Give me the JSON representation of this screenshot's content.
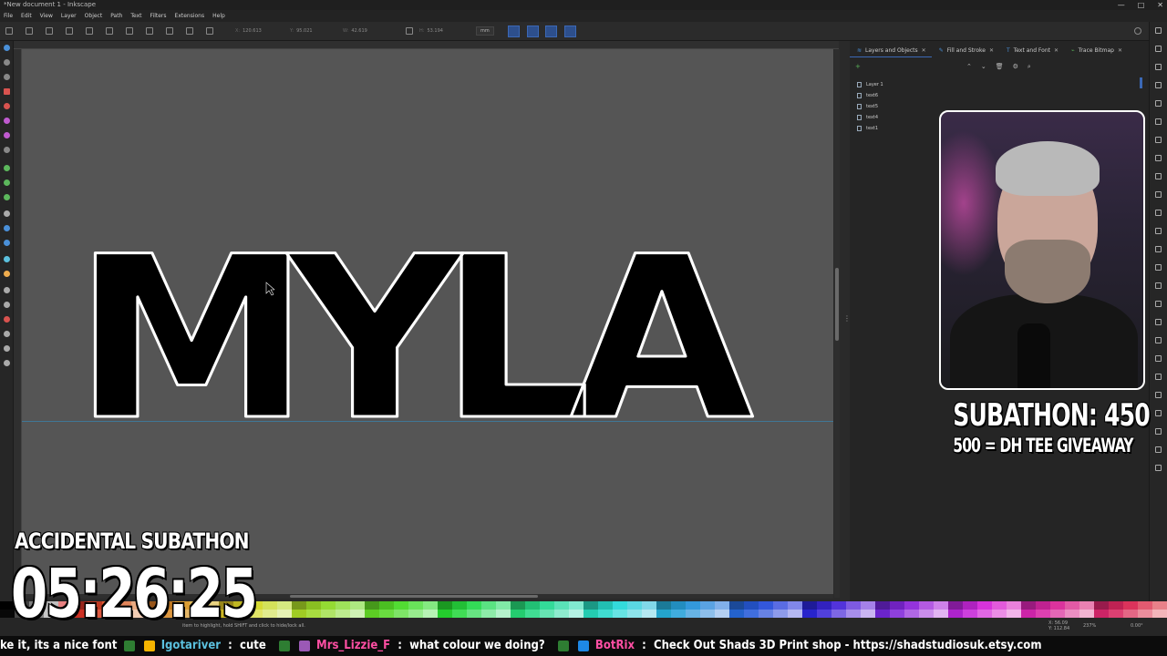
{
  "window": {
    "title": "*New document 1 - Inkscape"
  },
  "menu": [
    "File",
    "Edit",
    "View",
    "Layer",
    "Object",
    "Path",
    "Text",
    "Filters",
    "Extensions",
    "Help"
  ],
  "toolbar": {
    "x_label": "X:",
    "x_value": "120.613",
    "y_label": "Y:",
    "y_value": "95.021",
    "w_label": "W:",
    "w_value": "42.619",
    "h_label": "H:",
    "h_value": "53.194",
    "unit": "mm"
  },
  "dock": {
    "tabs": [
      {
        "label": "Layers and Objects"
      },
      {
        "label": "Fill and Stroke"
      },
      {
        "label": "Text and Font"
      },
      {
        "label": "Trace Bitmap"
      }
    ],
    "layers": [
      "Layer 1",
      "text6",
      "text5",
      "text4",
      "text1"
    ]
  },
  "canvas": {
    "artwork_text": "MYLA"
  },
  "status": {
    "message": "item to highlight, hold SHIFT and click to hide/lock all.",
    "x": "X: 56.09",
    "y": "Y: 112.84",
    "zoom": "237%",
    "rotation": "0.00°"
  },
  "overlay": {
    "subathon_line1": "SUBATHON: 450",
    "subathon_line2": "500 = DH TEE GIVEAWAY",
    "timer_label": "ACCIDENTAL SUBATHON",
    "timer_value": "05:26:25"
  },
  "chat": [
    {
      "user": "",
      "text": "ke it, its a nice font"
    },
    {
      "user": "Igotariver",
      "text": "cute"
    },
    {
      "user": "Mrs_Lizzie_F",
      "text": "what colour we doing?"
    },
    {
      "user": "BotRix",
      "text": "Check Out Shads 3D Print shop - https://shadstudiosuk.etsy.com"
    }
  ],
  "colors": {
    "accent": "#3b68b5",
    "canvas": "#555555",
    "guide": "#3b7fa8"
  }
}
